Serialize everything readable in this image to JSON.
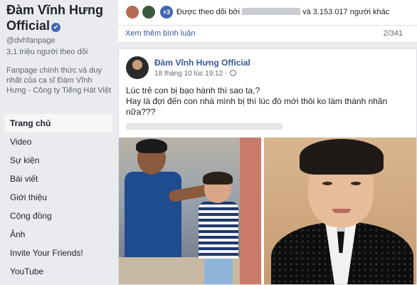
{
  "sidebar": {
    "page_name": "Đàm Vĩnh Hưng Official",
    "verified_mark": "✔",
    "handle": "@dvhfanpage",
    "followers": "3,1 triệu người theo dõi",
    "about": "Fanpage chính thức và duy nhất của ca sĩ Đàm Vĩnh Hưng - Công ty Tiếng Hát Việt",
    "nav": [
      {
        "label": "Trang chủ",
        "active": true
      },
      {
        "label": "Video"
      },
      {
        "label": "Sự kiện"
      },
      {
        "label": "Bài viết"
      },
      {
        "label": "Giới thiệu"
      },
      {
        "label": "Cộng đồng"
      },
      {
        "label": "Ảnh"
      },
      {
        "label": "Invite Your Friends!"
      },
      {
        "label": "YouTube"
      }
    ]
  },
  "followers_strip": {
    "badge": "+3",
    "prefix": "Được theo dõi bởi",
    "suffix": "và 3.153.017 người khác"
  },
  "comments": {
    "more_label": "Xem thêm bình luận",
    "count": "2/341"
  },
  "post": {
    "author": "Đàm Vĩnh Hưng Official",
    "timestamp": "18 tháng 10 lúc 19:12 ·",
    "text_line1": "Lúc trẻ con bị bạo hành thì sao ta,?",
    "text_line2": "Hay là đợi đến con nhà mình bị thì lúc đó mới thôi ko làm thánh nhân nữa???"
  },
  "colors": {
    "link": "#385898",
    "verified": "#4267b2",
    "background": "#e9ebee"
  },
  "icons": [
    "verified-badge-icon",
    "globe-icon",
    "follower-avatar-icon"
  ]
}
